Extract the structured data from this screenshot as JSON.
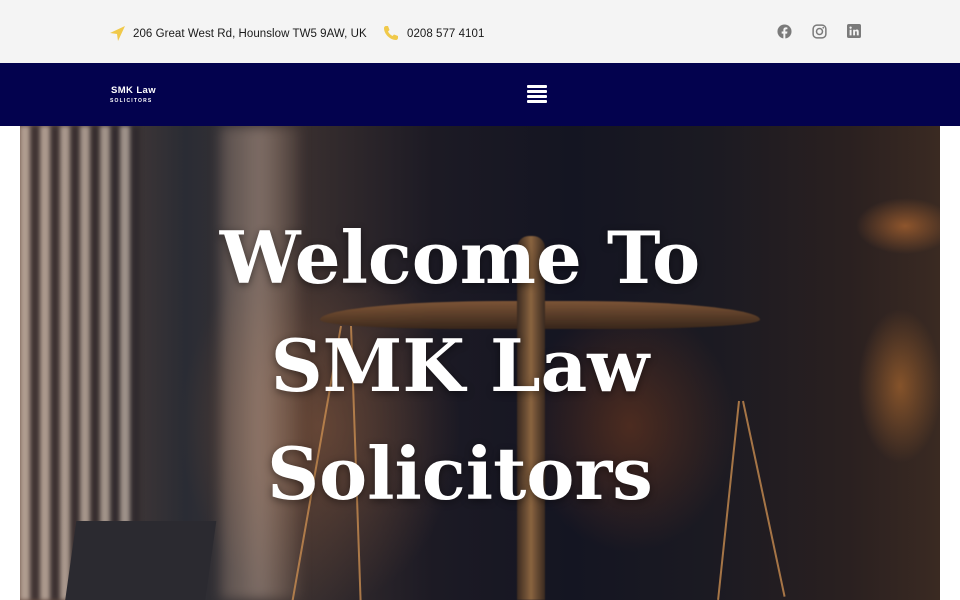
{
  "topbar": {
    "address": "206 Great West Rd, Hounslow TW5 9AW, UK",
    "phone": "0208 577 4101",
    "address_icon": "location-arrow-icon",
    "phone_icon": "phone-icon",
    "social": [
      {
        "name": "facebook",
        "icon": "facebook-icon"
      },
      {
        "name": "instagram",
        "icon": "instagram-icon"
      },
      {
        "name": "linkedin",
        "icon": "linkedin-icon"
      }
    ]
  },
  "nav": {
    "logo_line1": "SMK Law",
    "logo_line2": "SOLICITORS",
    "menu_icon": "hamburger-menu-icon"
  },
  "hero": {
    "headline": "Welcome To SMK Law Solicitors"
  },
  "colors": {
    "topbar_bg": "#f4f4f4",
    "navbar_bg": "#03024e",
    "accent_icon": "#f0c94a",
    "text_dark": "#1a1a1a",
    "social_grey": "#7a7a7a"
  }
}
